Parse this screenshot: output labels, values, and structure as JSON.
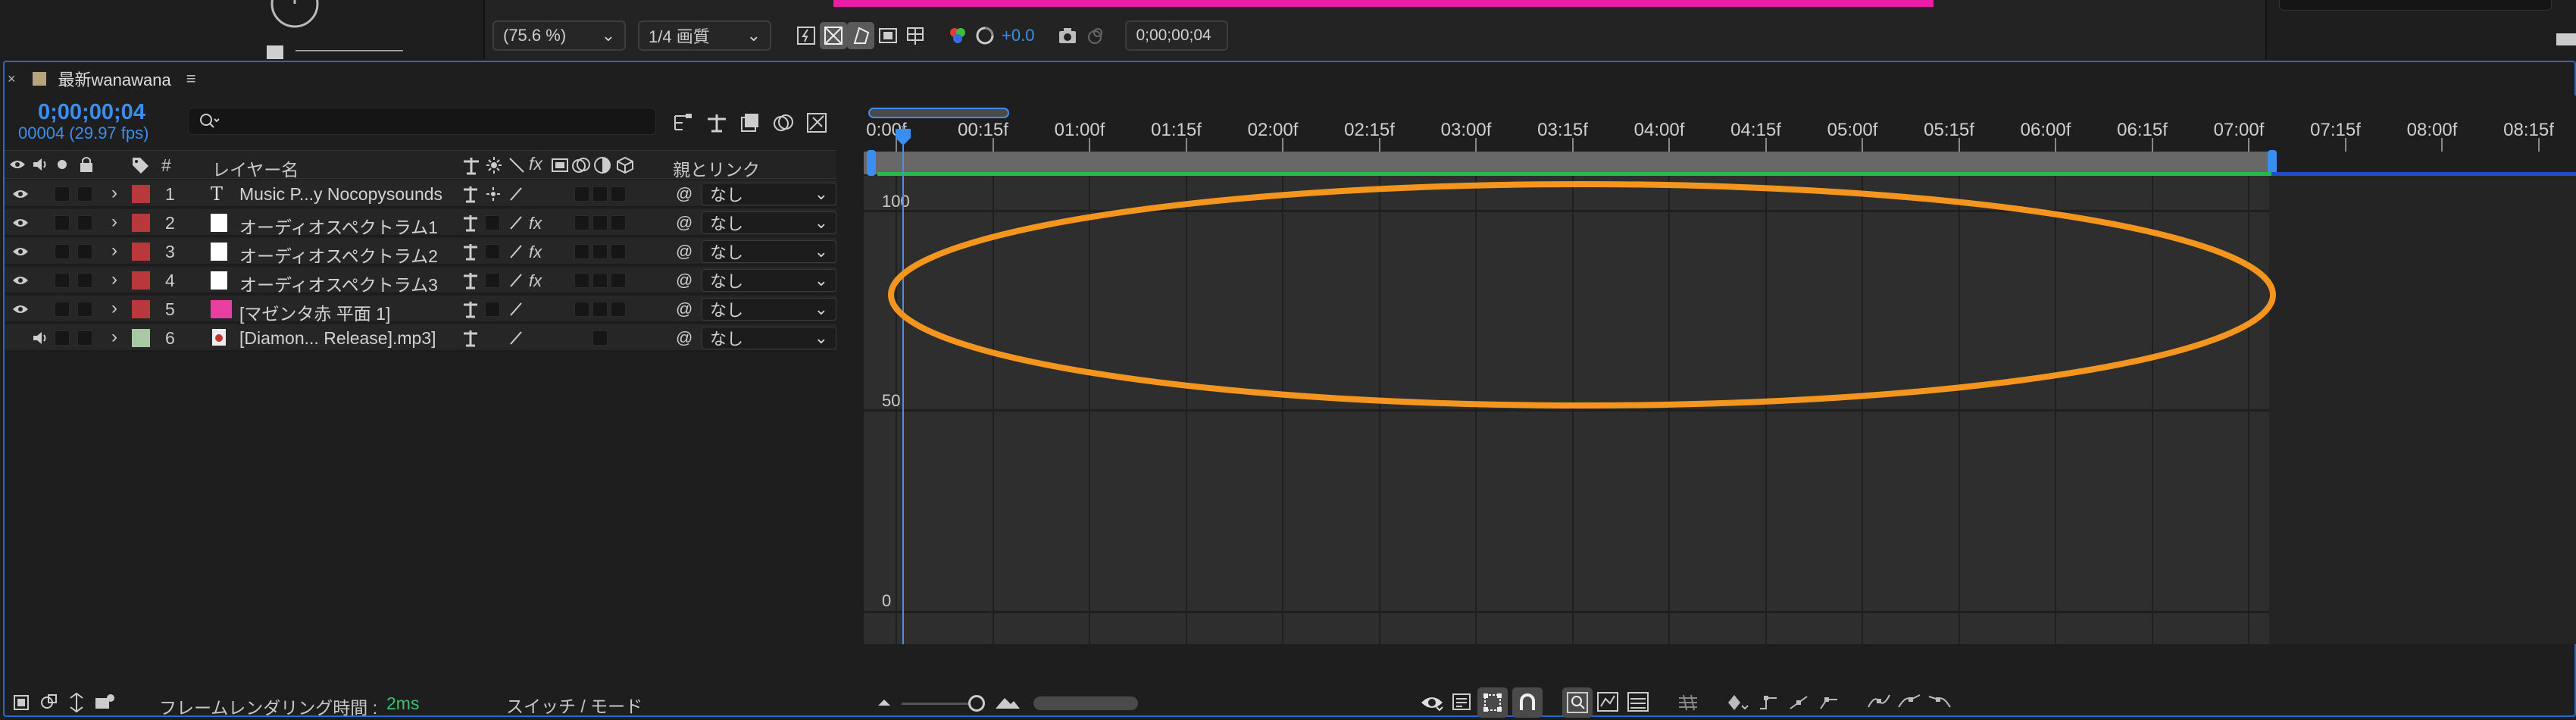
{
  "viewer": {
    "zoom": "(75.6 %)",
    "quality": "1/4 画質",
    "exposure": "+0.0",
    "current_time": "0;00;00;04"
  },
  "comp": {
    "tab_title": "最新wanawana",
    "timecode": "0;00;00;04",
    "fps_label": "00004 (29.97 fps)",
    "search_placeholder": ""
  },
  "columns": {
    "num": "#",
    "layer_name": "レイヤー名",
    "parent": "親とリンク"
  },
  "layers": [
    {
      "num": "1",
      "name": "Music P...y Nocopysounds",
      "type": "text",
      "label_color": "#b8383c",
      "parent": "なし",
      "has_fx": false
    },
    {
      "num": "2",
      "name": "オーディオスペクトラム1",
      "type": "solid",
      "label_color": "#b8383c",
      "parent": "なし",
      "has_fx": true
    },
    {
      "num": "3",
      "name": "オーディオスペクトラム2",
      "type": "solid",
      "label_color": "#b8383c",
      "parent": "なし",
      "has_fx": true
    },
    {
      "num": "4",
      "name": "オーディオスペクトラム3",
      "type": "solid",
      "label_color": "#b8383c",
      "parent": "なし",
      "has_fx": true
    },
    {
      "num": "5",
      "name": "[マゼンタ赤 平面 1]",
      "type": "solid-magenta",
      "label_color": "#b8383c",
      "parent": "なし",
      "has_fx": false
    },
    {
      "num": "6",
      "name": "[Diamon... Release].mp3]",
      "type": "audio",
      "label_color": "#a8c8a4",
      "parent": "なし",
      "has_fx": false
    }
  ],
  "timeline": {
    "ruler_labels": [
      "0:00f",
      "00:15f",
      "01:00f",
      "01:15f",
      "02:00f",
      "02:15f",
      "03:00f",
      "03:15f",
      "04:00f",
      "04:15f",
      "05:00f",
      "05:15f",
      "06:00f",
      "06:15f",
      "07:00f",
      "07:15f",
      "08:00f",
      "08:15f"
    ],
    "graph_ticks": [
      "100",
      "50",
      "0"
    ]
  },
  "status": {
    "render_time_label": "フレームレンダリング時間 :",
    "render_time_value": "2ms",
    "switch_mode": "スイッチ / モード"
  },
  "colors": {
    "accent_blue": "#3a8ef0",
    "annotation_orange": "#f4961e",
    "magenta": "#ea1ea6",
    "green_bar": "#2bb84a"
  }
}
